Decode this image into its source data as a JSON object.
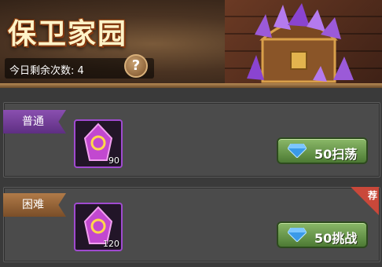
{
  "banner": {
    "title": "保卫家园",
    "remaining_label": "今日剩余次数: 4",
    "help_symbol": "?"
  },
  "stages": [
    {
      "difficulty": "普通",
      "item_count": "90",
      "button_label": "50扫荡",
      "tag_color": "#6e3a96"
    },
    {
      "difficulty": "困难",
      "item_count": "120",
      "button_label": "50挑战",
      "tag_color": "#8a5a30",
      "corner_badge": "荐"
    }
  ],
  "colors": {
    "button_green": "#6a9a4c",
    "gem_blue": "#3a9ae8",
    "item_border": "#a04ad0",
    "badge_red": "#c9483a"
  }
}
